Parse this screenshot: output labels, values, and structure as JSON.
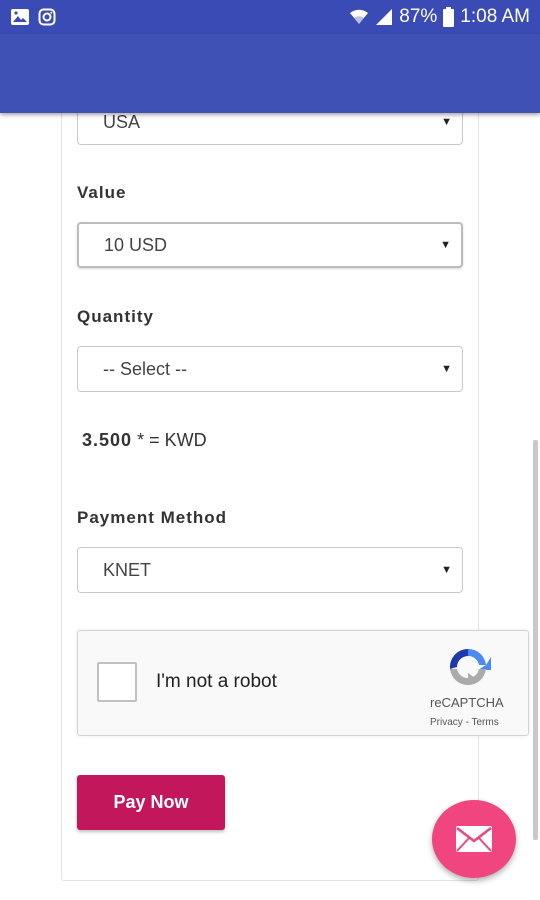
{
  "status_bar": {
    "battery": "87%",
    "time": "1:08 AM"
  },
  "form": {
    "country_value": "USA",
    "value_label": "Value",
    "value_selected": "10 USD",
    "quantity_label": "Quantity",
    "quantity_selected": "-- Select --",
    "price_amount": "3.500",
    "price_rest": "* = KWD",
    "payment_label": "Payment Method",
    "payment_selected": "KNET"
  },
  "recaptcha": {
    "text": "I'm not a robot",
    "brand": "reCAPTCHA",
    "links": "Privacy - Terms"
  },
  "pay_button": "Pay Now",
  "colors": {
    "app_bar": "#3f51b5",
    "status_bar": "#3a4bb5",
    "pay_button": "#c2185b",
    "fab": "#f0457e"
  },
  "icons": [
    "image-icon",
    "instagram-icon",
    "wifi-icon",
    "signal-icon",
    "battery-icon",
    "mail-icon",
    "recaptcha-logo-icon"
  ]
}
